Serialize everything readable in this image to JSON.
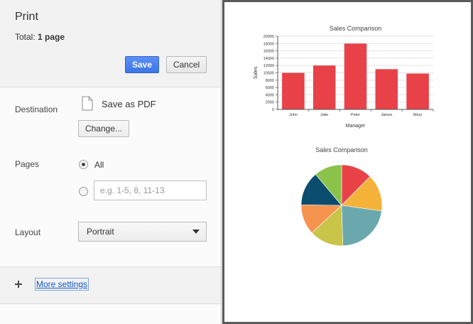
{
  "dialog": {
    "title": "Print",
    "total_prefix": "Total:",
    "total_value": "1 page",
    "save_label": "Save",
    "cancel_label": "Cancel"
  },
  "destination": {
    "label": "Destination",
    "value": "Save as PDF",
    "change_label": "Change..."
  },
  "pages": {
    "label": "Pages",
    "all_label": "All",
    "all_selected": true,
    "custom_placeholder": "e.g. 1-5, 8, 11-13",
    "custom_value": ""
  },
  "layout": {
    "label": "Layout",
    "selected": "Portrait"
  },
  "more_settings": {
    "label": "More settings"
  },
  "colors": {
    "accent": "#4285f4",
    "bar": "#e84148",
    "link": "#1558c8"
  },
  "chart_data": [
    {
      "type": "bar",
      "title": "Sales Comparison",
      "xlabel": "Manager",
      "ylabel": "Sales",
      "categories": [
        "John",
        "Jake",
        "Peter",
        "James",
        "Mary"
      ],
      "values": [
        10000,
        12000,
        18000,
        11000,
        9800
      ],
      "ylim": [
        0,
        20000
      ],
      "yticks": [
        0,
        2000,
        4000,
        6000,
        8000,
        10000,
        12000,
        14000,
        16000,
        18000,
        20000
      ],
      "grid": true,
      "color": "#e84148"
    },
    {
      "type": "pie",
      "title": "Sales Comparison",
      "values": [
        10000,
        12000,
        18000,
        11000,
        9800,
        11000,
        9000
      ],
      "colors": [
        "#e84148",
        "#f5b33a",
        "#6aa8ad",
        "#c8c549",
        "#f5944f",
        "#0a4d6e",
        "#8bc34a"
      ]
    }
  ]
}
